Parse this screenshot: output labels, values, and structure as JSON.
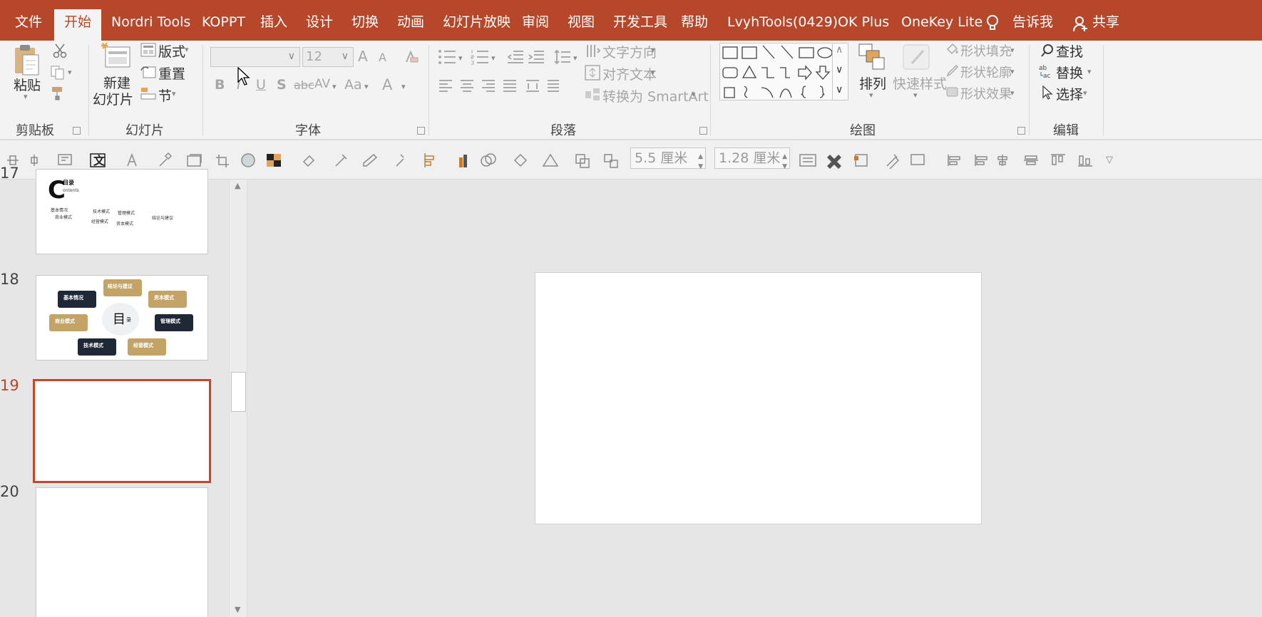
{
  "tabs": [
    {
      "label": "文件",
      "active": false
    },
    {
      "label": "开始",
      "active": true
    },
    {
      "label": "Nordri Tools",
      "active": false
    },
    {
      "label": "KOPPT",
      "active": false
    },
    {
      "label": "插入",
      "active": false
    },
    {
      "label": "设计",
      "active": false
    },
    {
      "label": "切换",
      "active": false
    },
    {
      "label": "动画",
      "active": false
    },
    {
      "label": "幻灯片放映",
      "active": false
    },
    {
      "label": "审阅",
      "active": false
    },
    {
      "label": "视图",
      "active": false
    },
    {
      "label": "开发工具",
      "active": false
    },
    {
      "label": "帮助",
      "active": false
    },
    {
      "label": "LvyhTools(0429)",
      "active": false
    },
    {
      "label": "OK Plus",
      "active": false
    },
    {
      "label": "OneKey Lite",
      "active": false
    }
  ],
  "tell_me": "告诉我",
  "share": "共享",
  "clipboard": {
    "paste": "粘贴",
    "group": "剪贴板"
  },
  "slides_group": {
    "new_slide_1": "新建",
    "new_slide_2": "幻灯片",
    "layout": "版式",
    "reset": "重置",
    "section": "节",
    "group": "幻灯片"
  },
  "font_group": {
    "font_size": "12",
    "group": "字体",
    "bold": "B",
    "italic": "I",
    "underline": "U",
    "shadow": "S",
    "strike": "abc",
    "spacing": "AV",
    "case": "Aa",
    "grow": "A",
    "shrink": "A",
    "color": "A"
  },
  "paragraph_group": {
    "text_direction": "文字方向",
    "align_text": "对齐文本",
    "smartart": "转换为 SmartArt",
    "group": "段落"
  },
  "drawing_group": {
    "arrange": "排列",
    "quick_styles": "快速样式",
    "shape_fill": "形状填充",
    "shape_outline": "形状轮廓",
    "shape_effects": "形状效果",
    "group": "绘图"
  },
  "editing_group": {
    "find": "查找",
    "replace": "替换",
    "select": "选择",
    "group": "编辑"
  },
  "quickbar": {
    "width": "5.5 厘米",
    "height": "1.28 厘米"
  },
  "slides": [
    {
      "number": "17",
      "title_letter": "C",
      "title": "目录",
      "subtitle": "ontents",
      "items": [
        "基本情况",
        "商业模式",
        "技术模式",
        "经营模式",
        "管理模式",
        "资本模式",
        "结论与建议"
      ]
    },
    {
      "number": "18",
      "center": "目",
      "center_small": "录",
      "bubbles": [
        "基本情况",
        "结论与建议",
        "资本模式",
        "商业模式",
        "管理模式",
        "技术模式",
        "经营模式"
      ]
    },
    {
      "number": "19"
    },
    {
      "number": "20"
    }
  ],
  "colors": {
    "accent": "#b7472a",
    "selection": "#c7462b",
    "navy": "#1f2837",
    "gold": "#c4a366"
  }
}
